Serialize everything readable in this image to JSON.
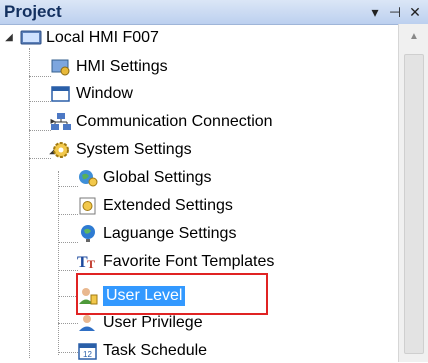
{
  "panel": {
    "title": "Project",
    "dropdown_glyph": "▾",
    "pin_glyph": "⊣",
    "close_glyph": "✕"
  },
  "tree": {
    "root": {
      "label": "Local HMI F007",
      "icon": "hmi-monitor-icon"
    },
    "items": [
      {
        "label": "HMI Settings",
        "icon": "hmi-settings-icon"
      },
      {
        "label": "Window",
        "icon": "window-icon"
      },
      {
        "label": "Communication Connection",
        "icon": "network-icon"
      },
      {
        "label": "System Settings",
        "icon": "gear-icon"
      },
      {
        "label": "Global Settings",
        "icon": "globe-settings-icon"
      },
      {
        "label": "Extended Settings",
        "icon": "extended-settings-icon"
      },
      {
        "label": "Laguange Settings",
        "icon": "language-globe-icon"
      },
      {
        "label": "Favorite Font Templates",
        "icon": "font-icon"
      },
      {
        "label": "User Level",
        "icon": "user-level-icon",
        "selected": true
      },
      {
        "label": "User Privilege",
        "icon": "user-privilege-icon"
      },
      {
        "label": "Task Schedule",
        "icon": "calendar-icon"
      }
    ]
  },
  "colors": {
    "selection": "#3399ff",
    "highlight_border": "#e02323",
    "header_text": "#13305f"
  }
}
